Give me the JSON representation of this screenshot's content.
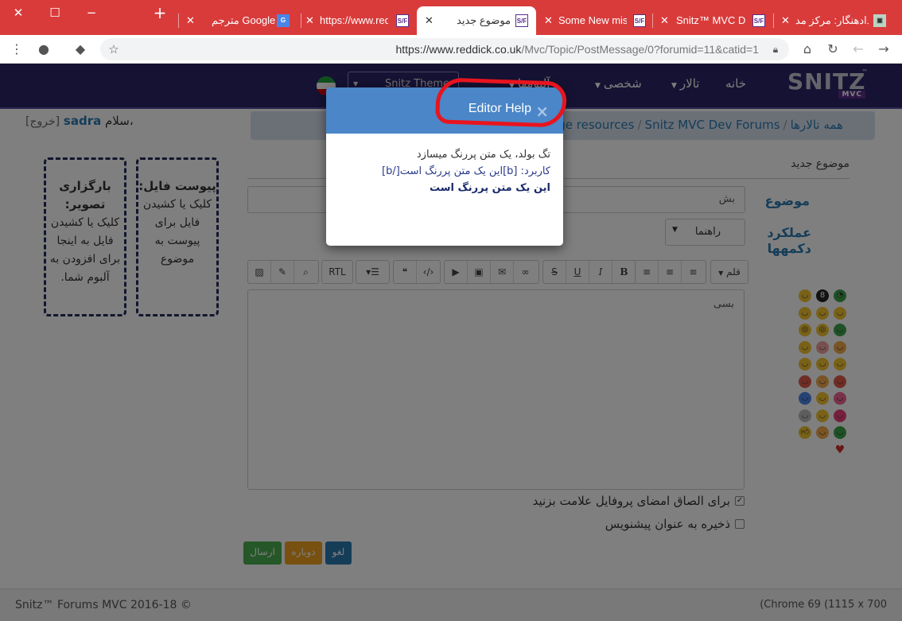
{
  "browser": {
    "tabs": [
      {
        "title": "دادهنگار: مرکز مد",
        "favicon": "picture-favicon"
      },
      {
        "title": "Snitz™ MVC Dev",
        "favicon": "snitz-favicon"
      },
      {
        "title": "Some New miss",
        "favicon": "snitz-favicon"
      },
      {
        "title": "موضوع جدید",
        "favicon": "snitz-favicon",
        "active": true
      },
      {
        "title": "https://www.red",
        "favicon": "snitz-favicon"
      },
      {
        "title": "مترجم Google",
        "favicon": "google-translate-favicon"
      }
    ],
    "new_tab": "+",
    "url_host": "https://www.reddick.co.uk",
    "url_path": "/Mvc/Topic/PostMessage/0?forumid=11&catid=1"
  },
  "nav": {
    "logo": "SNITZ",
    "logo_tm": "™",
    "logo_mvc": "MVC",
    "items": [
      "خانه",
      "تالار",
      "شخصی",
      "آلبومها"
    ],
    "theme": "Snitz Theme"
  },
  "user": {
    "greeting": "سلام،",
    "name": "sadra",
    "logout": "[خروج]"
  },
  "breadcrumb": [
    "همه تالارها",
    "Snitz MVC Dev Forums",
    "Usage resources"
  ],
  "uploads": {
    "attach_title": "پیوست فایل:",
    "attach_text": "کلیک یا کشیدن فایل برای پیوست به موضوع",
    "image_title": "بارگزاری تصویر:",
    "image_text": "کلیک یا کشیدن فایل به اینجا برای افزودن به آلبوم شما."
  },
  "form": {
    "section_title": "موضوع جدید",
    "subject_label": "موضوع",
    "subject_value": "بش",
    "buttons_label": "عملکرد دکمهها",
    "guide_select": "راهنما",
    "font_button": "قلم",
    "rtl_button": "RTL",
    "body_value": "بسی",
    "signature_check": "برای الصاق امضای پروفایل علامت بزنید",
    "draft_check": "ذخیره به عنوان پیشنویس",
    "send": "ارسال",
    "preview": "دوباره",
    "cancel": "لغو"
  },
  "footer": {
    "copyright": "Snitz™ Forums MVC 2016-18 ©",
    "resolution": "(Chrome 69 (1115 x 700"
  },
  "modal": {
    "title": "Editor Help",
    "close": "×",
    "line1": "تگ بولد، یک متن پررنگ میسازد",
    "line2": "کاربرد: [b]این یک متن پررنگ است[/b]",
    "line3": "این یک متن پررنگ است"
  },
  "colors": {
    "tabbar": "#d93b3b",
    "navbar": "#2b2566",
    "modal_header": "#4a86c8",
    "annotation": "#e8141e"
  }
}
